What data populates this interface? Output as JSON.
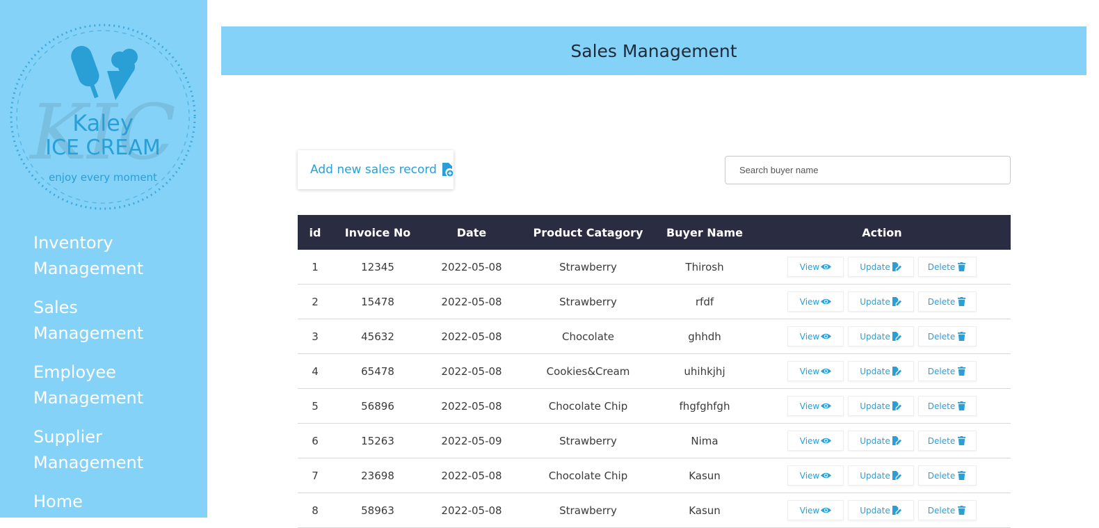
{
  "brand": {
    "monogram": "KIC",
    "name_line1": "Kaley",
    "name_line2": "ICE CREAM",
    "tagline": "enjoy every moment"
  },
  "sidebar": {
    "items": [
      {
        "label": "Inventory Management"
      },
      {
        "label": "Sales Management"
      },
      {
        "label": "Employee Management"
      },
      {
        "label": "Supplier Management"
      },
      {
        "label": "Home"
      }
    ]
  },
  "header": {
    "title": "Sales Management"
  },
  "toolbar": {
    "add_label": "Add new sales record",
    "add_icon": "file-add-icon",
    "search_placeholder": "Search buyer name",
    "search_value": ""
  },
  "table": {
    "columns": [
      "id",
      "Invoice No",
      "Date",
      "Product Catagory",
      "Buyer Name",
      "Action"
    ],
    "rows": [
      {
        "id": "1",
        "invoice": "12345",
        "date": "2022-05-08",
        "category": "Strawberry",
        "buyer": "Thirosh"
      },
      {
        "id": "2",
        "invoice": "15478",
        "date": "2022-05-08",
        "category": "Strawberry",
        "buyer": "rfdf"
      },
      {
        "id": "3",
        "invoice": "45632",
        "date": "2022-05-08",
        "category": "Chocolate",
        "buyer": "ghhdh"
      },
      {
        "id": "4",
        "invoice": "65478",
        "date": "2022-05-08",
        "category": "Cookies&Cream",
        "buyer": "uhihkjhj"
      },
      {
        "id": "5",
        "invoice": "56896",
        "date": "2022-05-08",
        "category": "Chocolate Chip",
        "buyer": "fhgfghfgh"
      },
      {
        "id": "6",
        "invoice": "15263",
        "date": "2022-05-09",
        "category": "Strawberry",
        "buyer": "Nima"
      },
      {
        "id": "7",
        "invoice": "23698",
        "date": "2022-05-08",
        "category": "Chocolate Chip",
        "buyer": "Kasun"
      },
      {
        "id": "8",
        "invoice": "58963",
        "date": "2022-05-08",
        "category": "Strawberry",
        "buyer": "Kasun"
      }
    ],
    "actions": {
      "view": "View",
      "view_icon": "eye-icon",
      "update": "Update",
      "update_icon": "file-edit-icon",
      "delete": "Delete",
      "delete_icon": "trash-icon"
    }
  },
  "colors": {
    "sidebar_bg": "#84d2f7",
    "header_bg": "#84d2f7",
    "table_header_bg": "#2a2d42",
    "accent": "#2a9fd6"
  }
}
